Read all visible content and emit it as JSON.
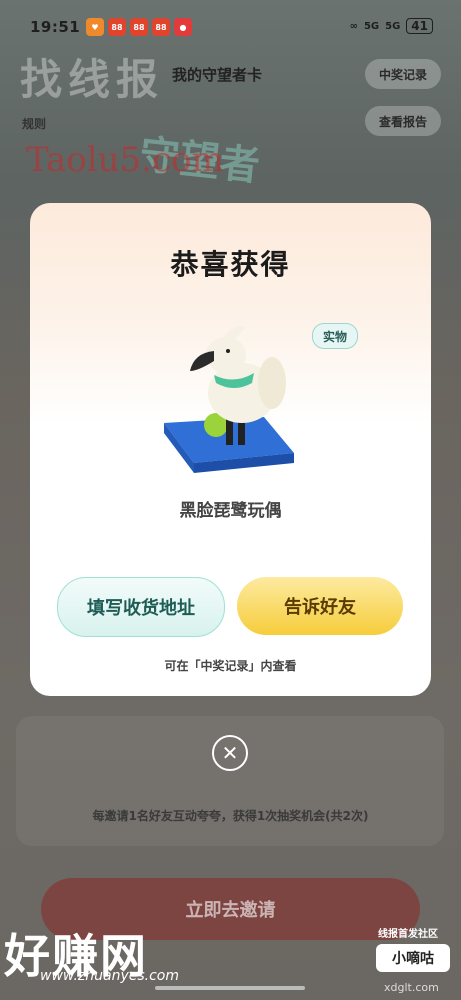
{
  "status_bar": {
    "time": "19:51",
    "app_icons": [
      "heart-app",
      "app-88-a",
      "app-88-b",
      "app-88-c",
      "red-app"
    ],
    "signal1": "5G",
    "signal2": "5G",
    "battery": "41"
  },
  "background": {
    "watermark_top": "找线报",
    "page_title": "我的守望者卡",
    "prize_record_button": "中奖记录",
    "view_report_button": "查看报告",
    "rules_button": "规则",
    "hero_title": "守望者",
    "watermark_mid": "Taolu5.com"
  },
  "modal": {
    "title": "恭喜获得",
    "tag": "实物",
    "prize_name": "黑脸琵鹭玩偶",
    "address_button": "填写收货地址",
    "tell_friends_button": "告诉好友",
    "hint": "可在「中奖记录」内查看"
  },
  "lower": {
    "invite_text": "每邀请1名好友互动夸夸，获得1次抽奖机会(共2次)",
    "invite_button": "立即去邀请"
  },
  "watermarks": {
    "bottom_brand": "好赚网",
    "bottom_url": "www.zhuanyes.com",
    "community_label": "线报首发社区",
    "community_badge": "小嘀咕",
    "domain": "xdglt.com"
  },
  "colors": {
    "tell_button": "#f6cd3b",
    "address_button_border": "#9fe0d7",
    "invite_button": "#8c2828"
  }
}
